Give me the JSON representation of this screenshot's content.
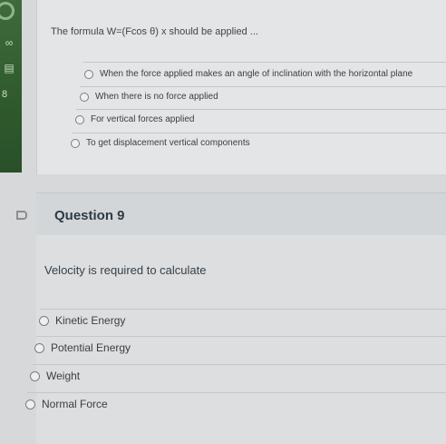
{
  "sidebar": {
    "number": "8"
  },
  "question8": {
    "stem": "The formula W=(Fcos θ) x should be applied ...",
    "options": [
      "When the force applied makes an angle of inclination with the horizontal plane",
      "When there is no force applied",
      "For vertical forces applied",
      "To get displacement vertical components"
    ]
  },
  "question9": {
    "title": "Question 9",
    "stem": "Velocity is required to calculate",
    "options": [
      "Kinetic Energy",
      "Potential Energy",
      "Weight",
      "Normal Force"
    ]
  }
}
